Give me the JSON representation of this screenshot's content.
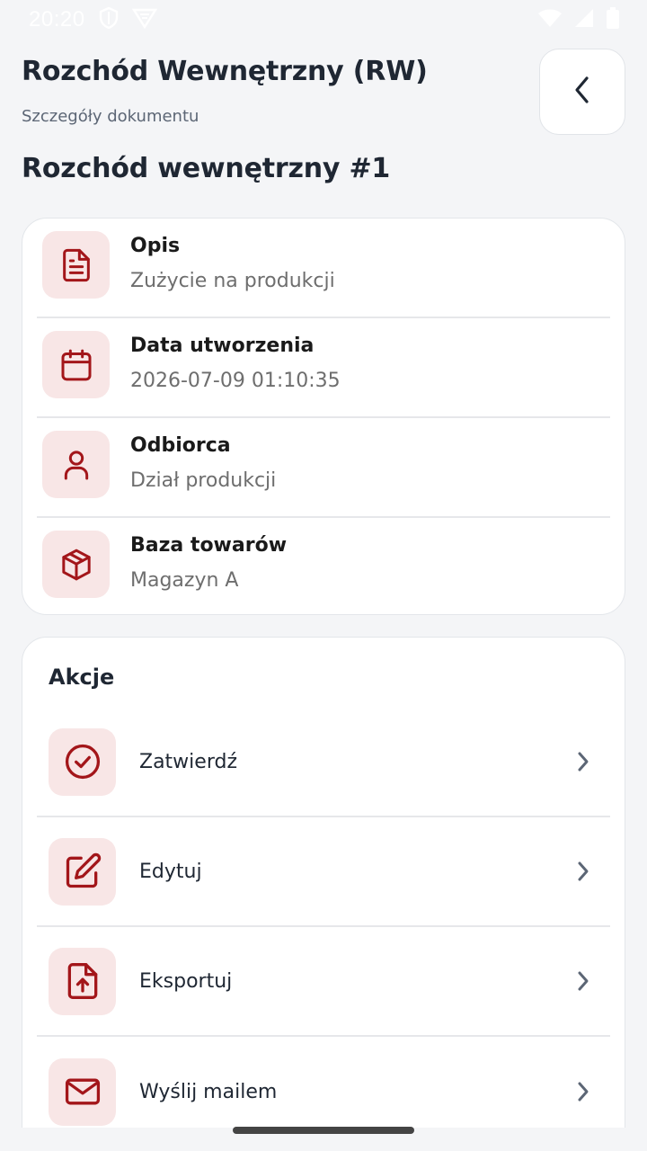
{
  "status_bar": {
    "time": "20:20",
    "left_icons": [
      "shield-icon",
      "vpn-icon"
    ],
    "right_icons": [
      "wifi-icon",
      "signal-icon",
      "battery-icon"
    ]
  },
  "header": {
    "title": "Rozchód Wewnętrzny (RW)",
    "subtitle": "Szczegóły dokumentu",
    "back_icon": "chevron-left-icon"
  },
  "document": {
    "title": "Rozchód wewnętrzny #1"
  },
  "details": [
    {
      "icon": "document-icon",
      "label": "Opis",
      "value": "Zużycie na produkcji"
    },
    {
      "icon": "calendar-icon",
      "label": "Data utworzenia",
      "value": "2026-07-09 01:10:35"
    },
    {
      "icon": "user-icon",
      "label": "Odbiorca",
      "value": "Dział produkcji"
    },
    {
      "icon": "package-icon",
      "label": "Baza towarów",
      "value": "Magazyn A"
    }
  ],
  "actions": {
    "title": "Akcje",
    "items": [
      {
        "icon": "check-circle-icon",
        "label": "Zatwierdź"
      },
      {
        "icon": "edit-icon",
        "label": "Edytuj"
      },
      {
        "icon": "file-upload-icon",
        "label": "Eksportuj"
      },
      {
        "icon": "mail-icon",
        "label": "Wyślij mailem"
      }
    ]
  },
  "colors": {
    "accent": "#a3161a",
    "icon_background": "#f8e6e6",
    "page_background": "#f4f5f7"
  }
}
